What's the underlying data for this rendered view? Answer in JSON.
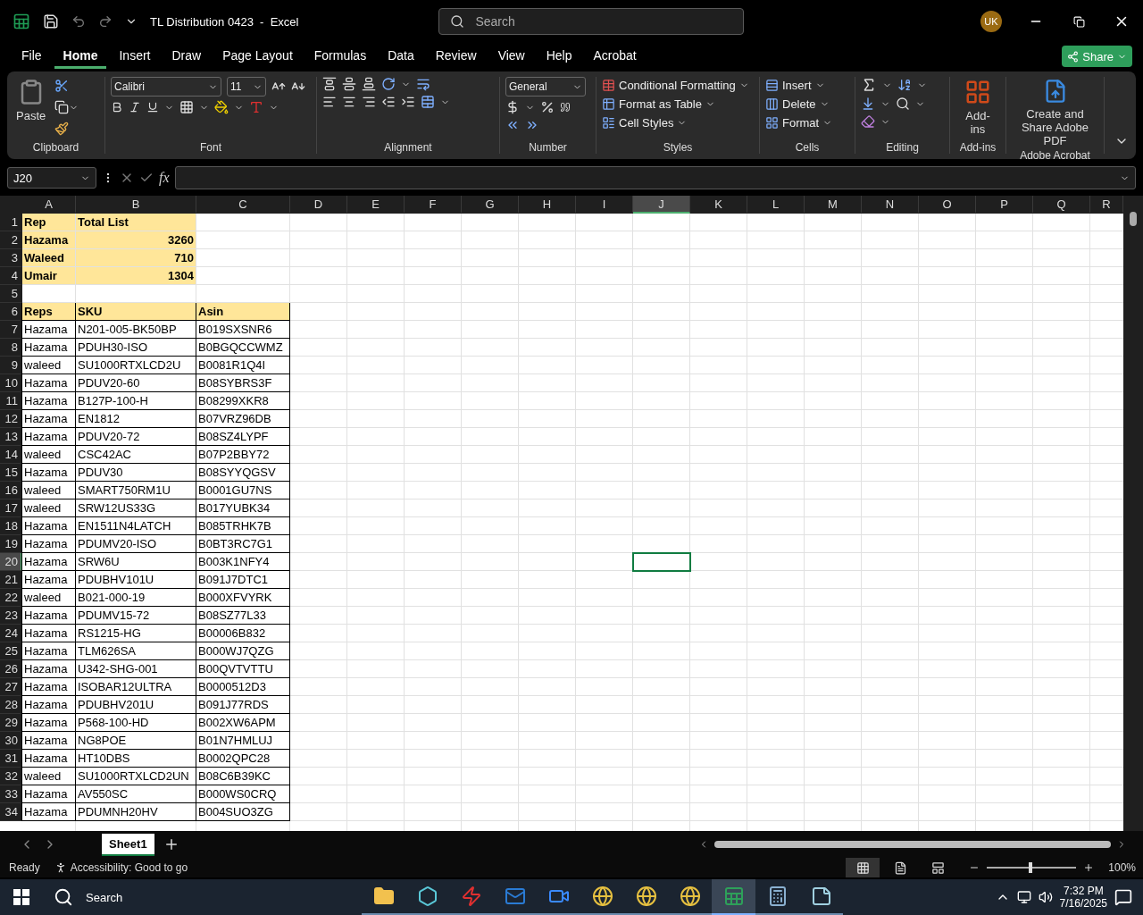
{
  "title_bar": {
    "document_title": "TL Distribution 0423  -  Excel",
    "search_placeholder": "Search",
    "avatar": "UK"
  },
  "menu_tabs": [
    {
      "label": "File",
      "selected": false
    },
    {
      "label": "Home",
      "selected": true
    },
    {
      "label": "Insert",
      "selected": false
    },
    {
      "label": "Draw",
      "selected": false
    },
    {
      "label": "Page Layout",
      "selected": false
    },
    {
      "label": "Formulas",
      "selected": false
    },
    {
      "label": "Data",
      "selected": false
    },
    {
      "label": "Review",
      "selected": false
    },
    {
      "label": "View",
      "selected": false
    },
    {
      "label": "Help",
      "selected": false
    },
    {
      "label": "Acrobat",
      "selected": false
    }
  ],
  "share_button": "Share",
  "ribbon": {
    "clipboard": {
      "paste": "Paste",
      "label": "Clipboard"
    },
    "font": {
      "font_name": "Calibri",
      "font_size": "11",
      "label": "Font"
    },
    "alignment": {
      "label": "Alignment"
    },
    "number": {
      "format": "General",
      "label": "Number"
    },
    "styles": {
      "items": [
        "Conditional Formatting",
        "Format as Table",
        "Cell Styles"
      ],
      "label": "Styles"
    },
    "cells": {
      "items": [
        "Insert",
        "Delete",
        "Format"
      ],
      "label": "Cells"
    },
    "editing": {
      "label": "Editing"
    },
    "addins": {
      "button": "Add-ins",
      "label": "Add-ins"
    },
    "acrobat": {
      "button": "Create and Share Adobe PDF",
      "label": "Adobe Acrobat"
    }
  },
  "formula_bar": {
    "name_box": "J20",
    "fx": "fx"
  },
  "sheet": {
    "columns": [
      {
        "label": "A",
        "selected": false
      },
      {
        "label": "B",
        "selected": false
      },
      {
        "label": "C",
        "selected": false
      },
      {
        "label": "D",
        "selected": false
      },
      {
        "label": "E",
        "selected": false
      },
      {
        "label": "F",
        "selected": false
      },
      {
        "label": "G",
        "selected": false
      },
      {
        "label": "H",
        "selected": false
      },
      {
        "label": "I",
        "selected": false
      },
      {
        "label": "J",
        "selected": true
      },
      {
        "label": "K",
        "selected": false
      },
      {
        "label": "L",
        "selected": false
      },
      {
        "label": "M",
        "selected": false
      },
      {
        "label": "N",
        "selected": false
      },
      {
        "label": "O",
        "selected": false
      },
      {
        "label": "P",
        "selected": false
      },
      {
        "label": "Q",
        "selected": false
      },
      {
        "label": "R",
        "selected": false
      }
    ],
    "rows": [
      {
        "number": "1",
        "kind": "summary_header",
        "selected": false,
        "cells": [
          "Rep",
          "Total List"
        ]
      },
      {
        "number": "2",
        "kind": "summary",
        "selected": false,
        "cells": [
          "Hazama",
          "3260"
        ]
      },
      {
        "number": "3",
        "kind": "summary",
        "selected": false,
        "cells": [
          "Waleed",
          "710"
        ]
      },
      {
        "number": "4",
        "kind": "summary",
        "selected": false,
        "cells": [
          "Umair",
          "1304"
        ]
      },
      {
        "number": "5",
        "kind": "blank",
        "selected": false
      },
      {
        "number": "6",
        "kind": "table_header",
        "selected": false,
        "cells": [
          "Reps",
          "SKU",
          "Asin"
        ]
      },
      {
        "number": "7",
        "kind": "table",
        "selected": false,
        "cells": [
          "Hazama",
          "N201-005-BK50BP",
          "B019SXSNR6"
        ]
      },
      {
        "number": "8",
        "kind": "table",
        "selected": false,
        "cells": [
          "Hazama",
          "PDUH30-ISO",
          "B0BGQCCWMZ"
        ]
      },
      {
        "number": "9",
        "kind": "table",
        "selected": false,
        "cells": [
          "waleed",
          "SU1000RTXLCD2U",
          "B0081R1Q4I"
        ]
      },
      {
        "number": "10",
        "kind": "table",
        "selected": false,
        "cells": [
          "Hazama",
          "PDUV20-60",
          "B08SYBRS3F"
        ]
      },
      {
        "number": "11",
        "kind": "table",
        "selected": false,
        "cells": [
          "Hazama",
          "B127P-100-H",
          "B08299XKR8"
        ]
      },
      {
        "number": "12",
        "kind": "table",
        "selected": false,
        "cells": [
          "Hazama",
          "EN1812",
          "B07VRZ96DB"
        ]
      },
      {
        "number": "13",
        "kind": "table",
        "selected": false,
        "cells": [
          "Hazama",
          "PDUV20-72",
          "B08SZ4LYPF"
        ]
      },
      {
        "number": "14",
        "kind": "table",
        "selected": false,
        "cells": [
          "waleed",
          "CSC42AC",
          "B07P2BBY72"
        ]
      },
      {
        "number": "15",
        "kind": "table",
        "selected": false,
        "cells": [
          "Hazama",
          "PDUV30",
          "B08SYYQGSV"
        ]
      },
      {
        "number": "16",
        "kind": "table",
        "selected": false,
        "cells": [
          "waleed",
          "SMART750RM1U",
          "B0001GU7NS"
        ]
      },
      {
        "number": "17",
        "kind": "table",
        "selected": false,
        "cells": [
          "waleed",
          "SRW12US33G",
          "B017YUBK34"
        ]
      },
      {
        "number": "18",
        "kind": "table",
        "selected": false,
        "cells": [
          "Hazama",
          "EN1511N4LATCH",
          "B085TRHK7B"
        ]
      },
      {
        "number": "19",
        "kind": "table",
        "selected": false,
        "cells": [
          "Hazama",
          "PDUMV20-ISO",
          "B0BT3RC7G1"
        ]
      },
      {
        "number": "20",
        "kind": "table",
        "selected": true,
        "cells": [
          "Hazama",
          "SRW6U",
          "B003K1NFY4"
        ]
      },
      {
        "number": "21",
        "kind": "table",
        "selected": false,
        "cells": [
          "Hazama",
          "PDUBHV101U",
          "B091J7DTC1"
        ]
      },
      {
        "number": "22",
        "kind": "table",
        "selected": false,
        "cells": [
          "waleed",
          "B021-000-19",
          "B000XFVYRK"
        ]
      },
      {
        "number": "23",
        "kind": "table",
        "selected": false,
        "cells": [
          "Hazama",
          "PDUMV15-72",
          "B08SZ77L33"
        ]
      },
      {
        "number": "24",
        "kind": "table",
        "selected": false,
        "cells": [
          "Hazama",
          "RS1215-HG",
          "B00006B832"
        ]
      },
      {
        "number": "25",
        "kind": "table",
        "selected": false,
        "cells": [
          "Hazama",
          "TLM626SA",
          "B000WJ7QZG"
        ]
      },
      {
        "number": "26",
        "kind": "table",
        "selected": false,
        "cells": [
          "Hazama",
          "U342-SHG-001",
          "B00QVTVTTU"
        ]
      },
      {
        "number": "27",
        "kind": "table",
        "selected": false,
        "cells": [
          "Hazama",
          "ISOBAR12ULTRA",
          "B0000512D3"
        ]
      },
      {
        "number": "28",
        "kind": "table",
        "selected": false,
        "cells": [
          "Hazama",
          "PDUBHV201U",
          "B091J77RDS"
        ]
      },
      {
        "number": "29",
        "kind": "table",
        "selected": false,
        "cells": [
          "Hazama",
          "P568-100-HD",
          "B002XW6APM"
        ]
      },
      {
        "number": "30",
        "kind": "table",
        "selected": false,
        "cells": [
          "Hazama",
          "NG8POE",
          "B01N7HMLUJ"
        ]
      },
      {
        "number": "31",
        "kind": "table",
        "selected": false,
        "cells": [
          "Hazama",
          "HT10DBS",
          "B0002QPC28"
        ]
      },
      {
        "number": "32",
        "kind": "table",
        "selected": false,
        "cells": [
          "waleed",
          "SU1000RTXLCD2UN",
          "B08C6B39KC"
        ]
      },
      {
        "number": "33",
        "kind": "table",
        "selected": false,
        "cells": [
          "Hazama",
          "AV550SC",
          "B000WS0CRQ"
        ]
      },
      {
        "number": "34",
        "kind": "table",
        "selected": false,
        "cells": [
          "Hazama",
          "PDUMNH20HV",
          "B004SUO3ZG"
        ]
      }
    ]
  },
  "sheet_tabs": [
    {
      "label": "Sheet1",
      "selected": true
    }
  ],
  "status_bar": {
    "status": "Ready",
    "accessibility": "Accessibility: Good to go",
    "views": [
      {
        "kind": "normal",
        "selected": true
      },
      {
        "kind": "page_layout",
        "selected": false
      },
      {
        "kind": "page_break",
        "selected": false
      }
    ],
    "zoom_slider": {
      "level": 0.47
    },
    "zoom": "100%"
  },
  "taskbar": {
    "search": "Search",
    "apps": [
      {
        "kind": "files",
        "selected": false
      },
      {
        "kind": "hexagon",
        "selected": false
      },
      {
        "kind": "ftp",
        "selected": false
      },
      {
        "kind": "mail",
        "selected": false
      },
      {
        "kind": "video",
        "selected": false
      },
      {
        "kind": "browser",
        "selected": false
      },
      {
        "kind": "browser",
        "selected": false
      },
      {
        "kind": "browser",
        "selected": false
      },
      {
        "kind": "spreadsheet",
        "selected": true
      },
      {
        "kind": "calculator",
        "selected": false
      },
      {
        "kind": "notes",
        "selected": false
      }
    ],
    "time": "7:32 PM",
    "date": "7/16/2025"
  }
}
